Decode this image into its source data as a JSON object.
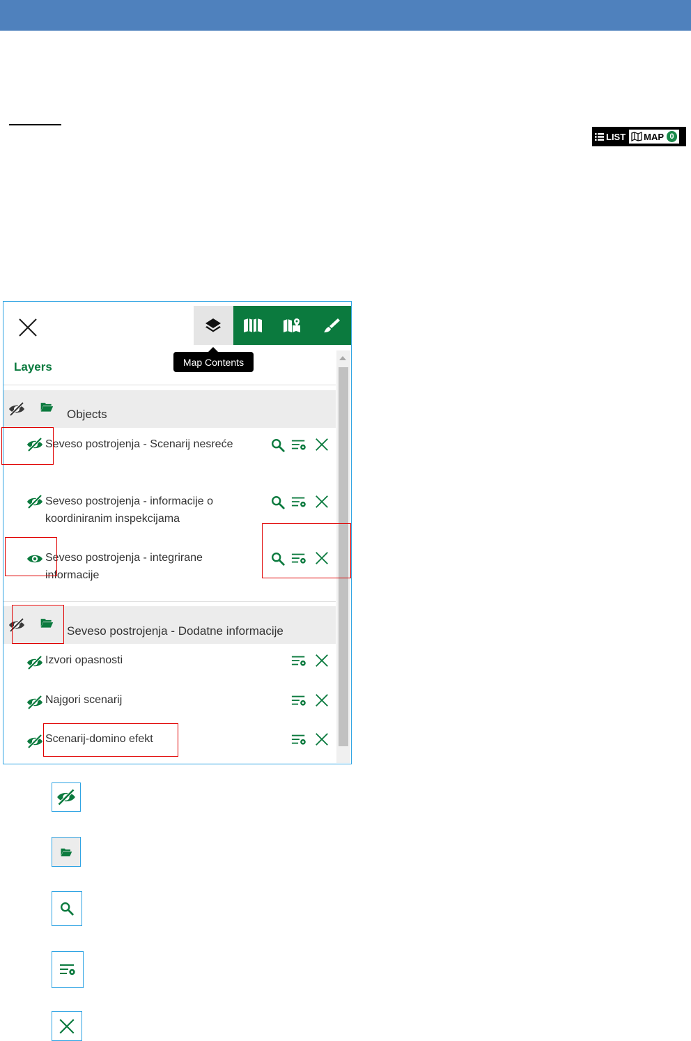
{
  "toggle": {
    "list_label": "LIST",
    "map_label": "MAP",
    "map_count": "0"
  },
  "panel": {
    "tooltip": "Map Contents",
    "section_title": "Layers",
    "toolbar_icons": [
      "layers-icon",
      "map-icon",
      "map-marker-icon",
      "brush-icon"
    ]
  },
  "groups": [
    {
      "label": "Objects",
      "layers": [
        {
          "label": "Seveso postrojenja - Scenarij nesreće",
          "visible": false
        },
        {
          "label": "Seveso postrojenja - informacije o koordiniranim inspekcijama",
          "visible": false
        },
        {
          "label": "Seveso postrojenja - integrirane informacije",
          "visible": true
        }
      ]
    },
    {
      "label": "Seveso postrojenja - Dodatne informacije",
      "layers": [
        {
          "label": "Izvori opasnosti",
          "visible": false
        },
        {
          "label": "Najgori scenarij",
          "visible": false
        },
        {
          "label": "Scenarij-domino efekt",
          "visible": false
        }
      ]
    }
  ],
  "legend_icons": [
    "eye-off-icon",
    "folder-icon",
    "zoom-icon",
    "layer-settings-icon",
    "remove-icon"
  ],
  "colors": {
    "header_blue": "#4f81bd",
    "accent_green": "#0b7a3e",
    "frame_blue": "#2ea3e3",
    "highlight_red": "#e00000"
  }
}
